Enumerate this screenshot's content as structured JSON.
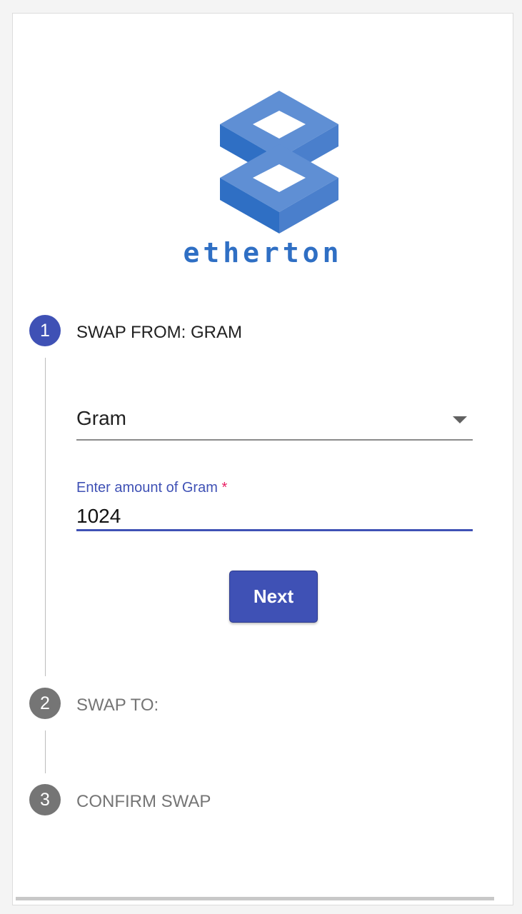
{
  "brand": {
    "name": "etherton",
    "color": "#2f6fc4"
  },
  "steps": [
    {
      "number": "1",
      "label": "SWAP FROM: GRAM",
      "state": "active"
    },
    {
      "number": "2",
      "label": "SWAP TO:",
      "state": "inactive"
    },
    {
      "number": "3",
      "label": "CONFIRM SWAP",
      "state": "inactive"
    }
  ],
  "form": {
    "currency_select": {
      "value": "Gram"
    },
    "amount_field": {
      "label": "Enter amount of Gram",
      "required_mark": "*",
      "value": "1024"
    },
    "next_label": "Next"
  },
  "colors": {
    "accent": "#3f51b5",
    "inactive": "#757575",
    "required": "#e91e63"
  }
}
